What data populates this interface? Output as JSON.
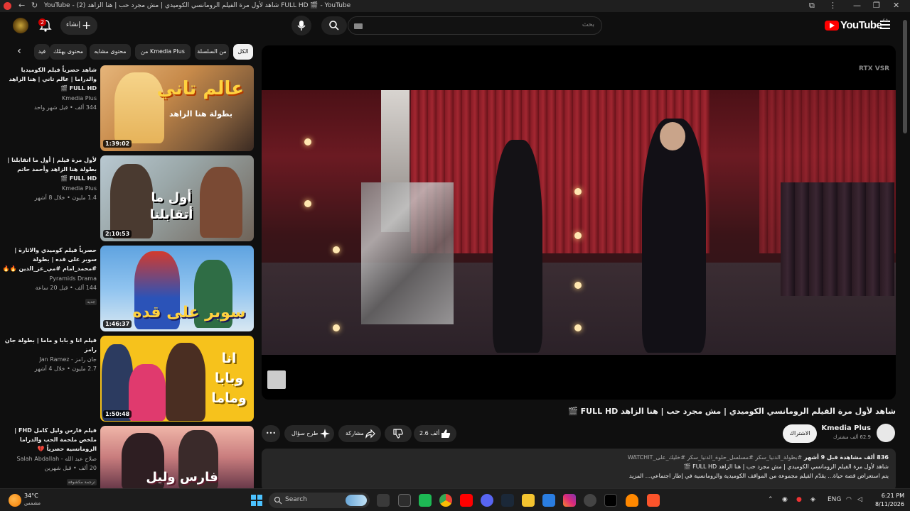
{
  "browser": {
    "tab_title": "YouTube - (2) شاهد لأول مرة الفيلم الرومانسي الكوميدي | مش مجرد حب | هنا الزاهد FULL HD 🎬 - YouTube"
  },
  "header": {
    "logo_text": "YouTube",
    "country_code": "SA",
    "search_placeholder": "بحث",
    "create_label": "إنشاء",
    "notification_count": "2"
  },
  "chips": [
    {
      "label": "الكل",
      "active": true
    },
    {
      "label": "من السلسلة",
      "active": false
    },
    {
      "label": "من Kmedia Plus",
      "active": false
    },
    {
      "label": "محتوى مشابه",
      "active": false
    },
    {
      "label": "محتوى يهمّك",
      "active": false
    },
    {
      "label": "فيد",
      "active": false
    }
  ],
  "recommendations": [
    {
      "title": "شاهد حصرياً فيلم الكوميديا والدراما | عالم تاني | هنا الزاهد FULL HD 🎬",
      "channel": "Kmedia Plus",
      "views": "344 ألف",
      "age": "قبل شهر واحد",
      "duration": "1:39:02",
      "thumb_text": "عالم تاني",
      "thumb_sub": "بطولة هنا الزاهد",
      "badge": ""
    },
    {
      "title": "لأول مرة فيلم | أول ما اتقابلنا | بطولة هنا الزاهد وأحمد حاتم FULL HD 🎬",
      "channel": "Kmedia Plus",
      "views": "1.4 مليون",
      "age": "خلال 8 أشهر",
      "duration": "2:10:53",
      "thumb_text": "أول ما أتقابلنا",
      "thumb_sub": "",
      "badge": ""
    },
    {
      "title": "حصرياً فيلم كوميدي والاثارة | سوبر على قده | بطولة #محمد_امام #مي_عز_الدين 🔥🔥",
      "channel": "Pyramids Drama",
      "views": "144 ألف",
      "age": "قبل 20 ساعة",
      "duration": "1:46:37",
      "thumb_text": "سوبر على قده",
      "thumb_sub": "",
      "badge": "جديد"
    },
    {
      "title": "فيلم انا و بابا و ماما | بطولة جان رامز",
      "channel": "جان رامز - Jan Ramez",
      "views": "2.7 مليون",
      "age": "خلال 4 أشهر",
      "duration": "1:50:48",
      "thumb_text": "انا وبابا وماما",
      "thumb_sub": "",
      "badge": ""
    },
    {
      "title": "فيلم فارس وليل كامل FHD | ملخص ملحمة الحب والدراما الرومانسية حصرياً 💔",
      "channel": "صلاح عبد الله - Salah Abdallah",
      "views": "20 ألف",
      "age": "قبل شهرين",
      "duration": "",
      "thumb_text": "فارس وليل",
      "thumb_sub": "",
      "badge": "ترجمة مكشوفة"
    }
  ],
  "player": {
    "watermark": "RTX VSR"
  },
  "video": {
    "title": "شاهد لأول مرة الفيلم الرومانسي الكوميدي | مش مجرد حب | هنا الزاهد FULL HD 🎬",
    "channel_name": "Kmedia Plus",
    "subscribers": "62.9 ألف مشترك",
    "subscribe_label": "الاشتراك",
    "likes": "2.6 ألف",
    "share_label": "مشاركة",
    "ask_label": "طرح سؤال",
    "more_label": "•••"
  },
  "description": {
    "stats": "836 ألف مشاهدة قبل 9 أشهر",
    "tags": "#بطولة_الدنيا_سكر #مسلسل_حلوة_الدنيا_سكر #خليك_على_WATCHIT",
    "line2": "شاهد لأول مرة الفيلم الرومانسي الكوميدي | مش مجرد حب | هنا الزاهد FULL HD 🎬",
    "line3": "يتم استعراض قصة حياة... يقدّم الفيلم مجموعة من المواقف الكوميدية والرومانسية في إطار اجتماعي... المزيد"
  },
  "taskbar": {
    "temperature": "34°C",
    "weather": "مشمس",
    "search_label": "Search",
    "language": "ENG",
    "time": "6:21 PM",
    "date": "8/11/2026"
  }
}
